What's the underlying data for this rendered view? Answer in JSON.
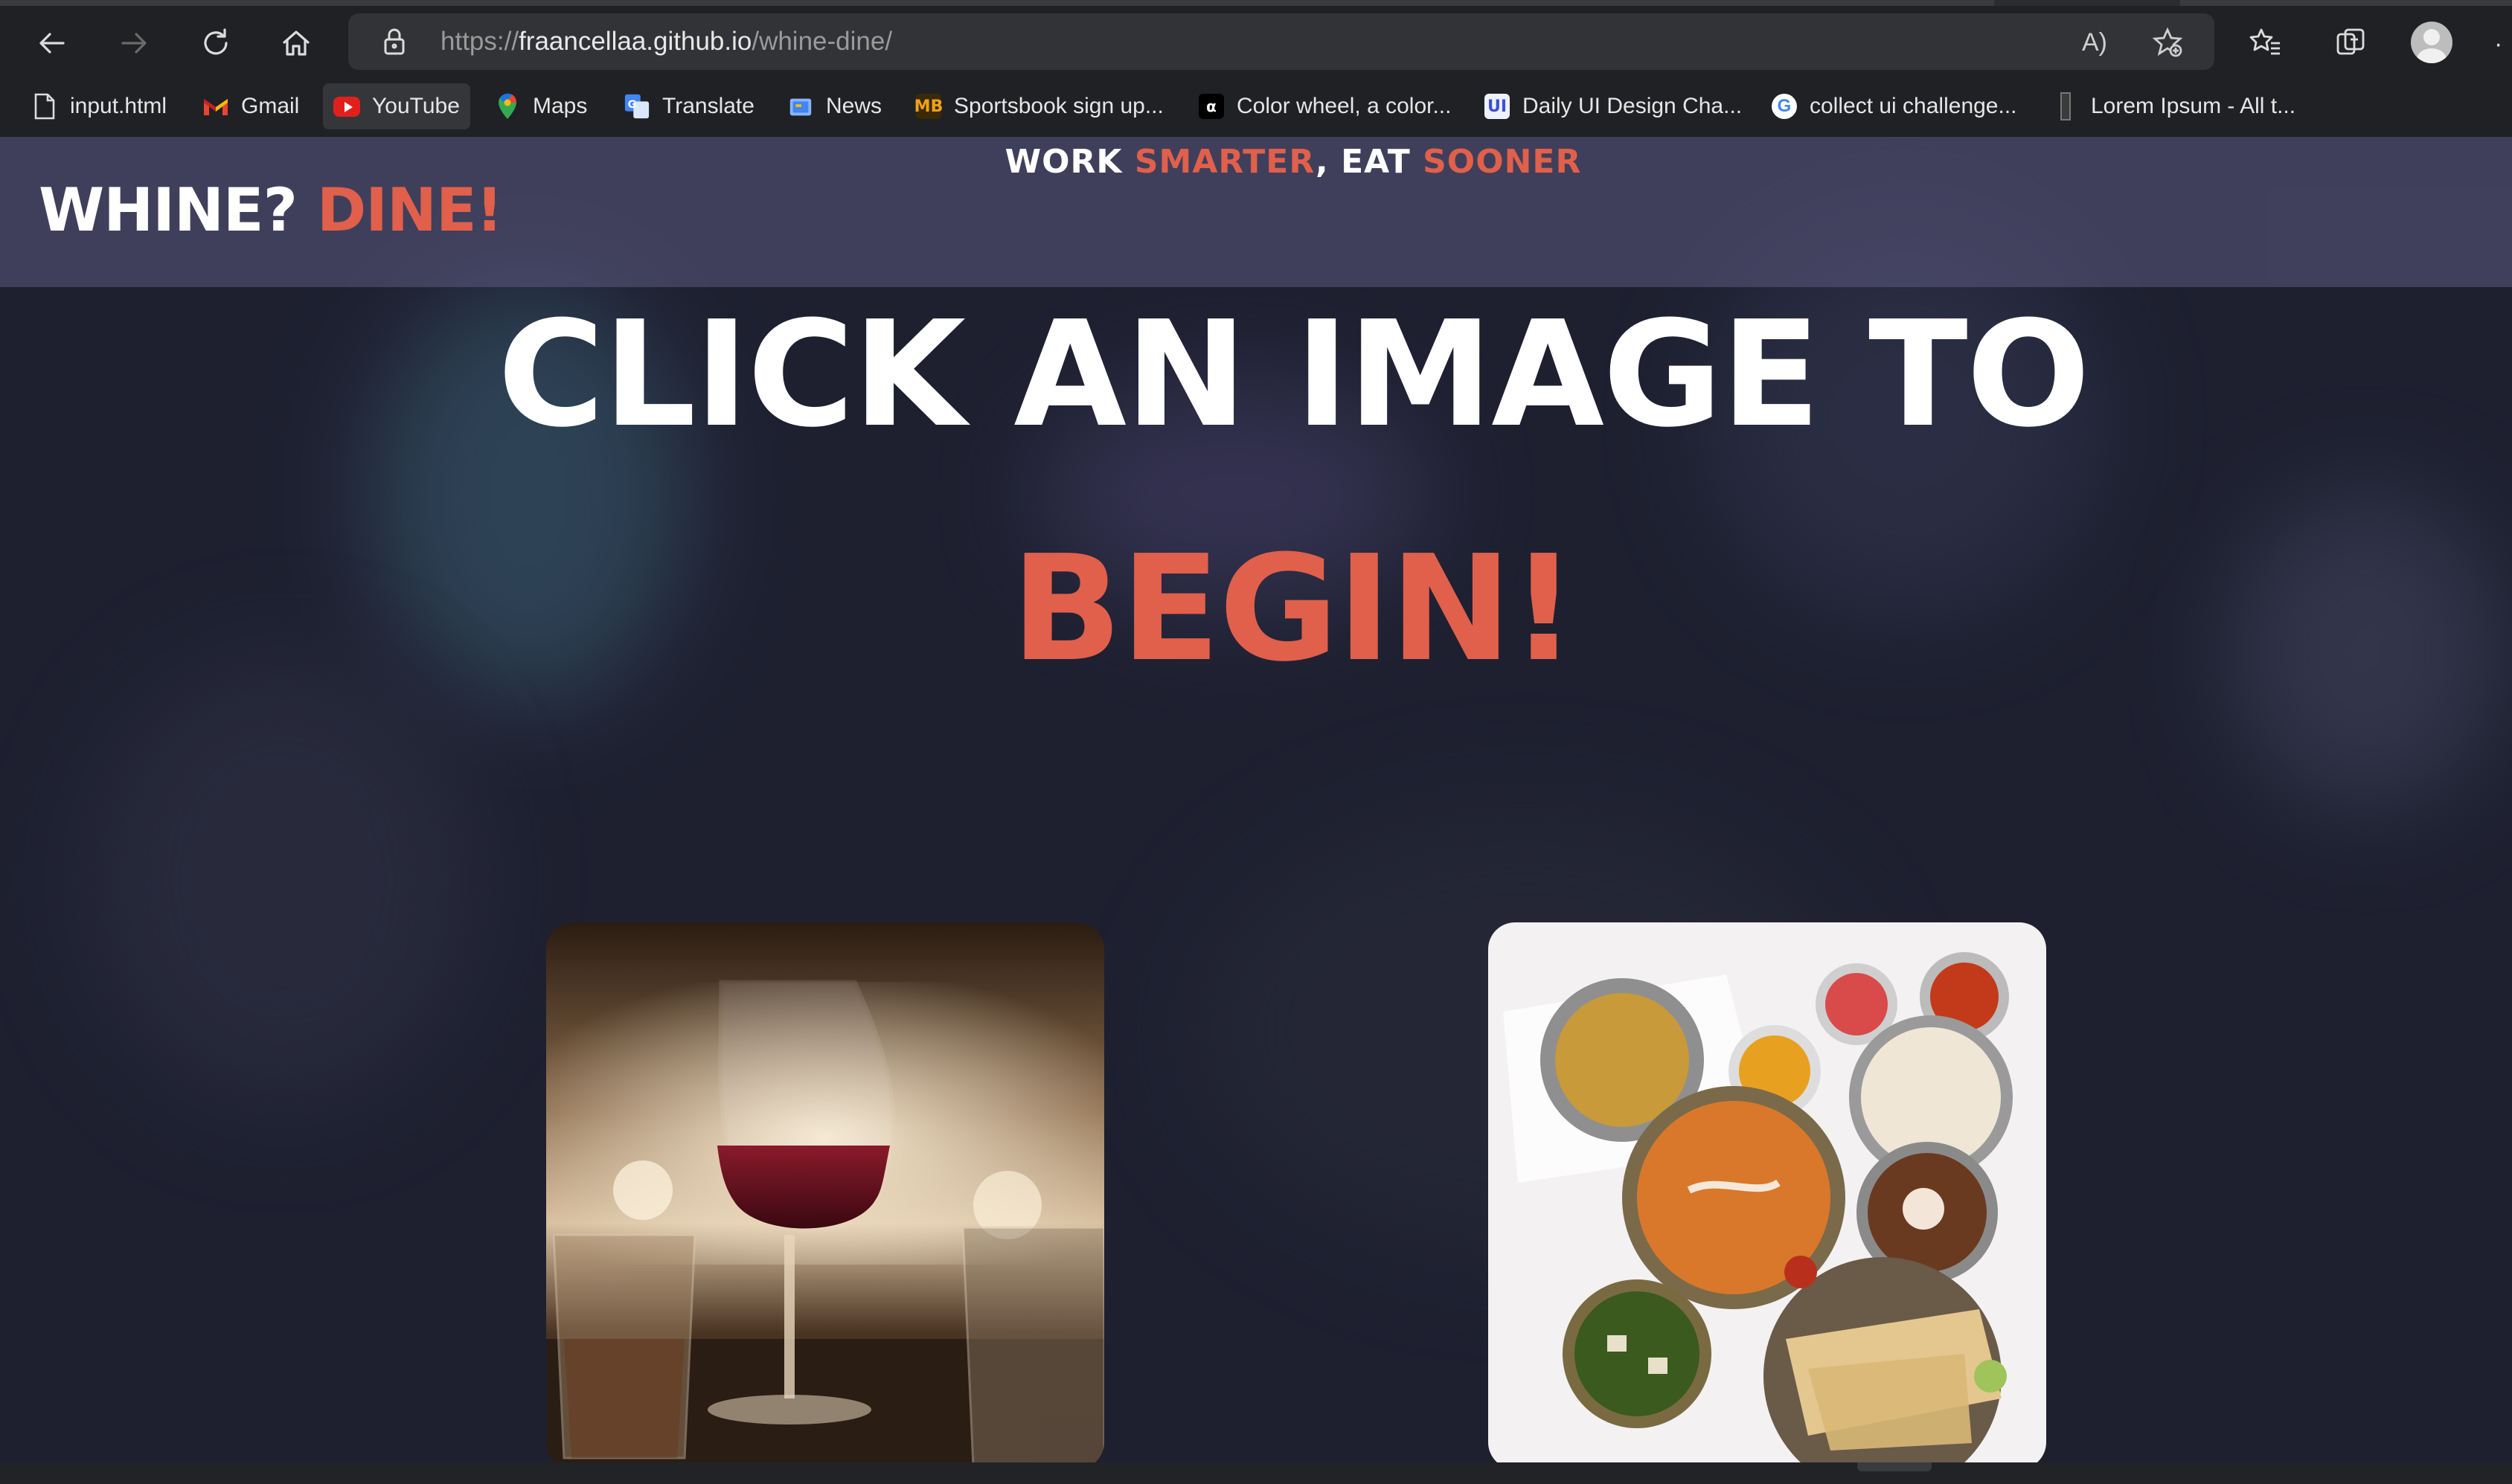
{
  "browser": {
    "url_scheme": "https://",
    "url_host": "fraancellaa.github.io",
    "url_path": "/whine-dine/",
    "read_aloud_label": "A)",
    "overflow_label": "·"
  },
  "bookmarks": [
    {
      "label": "input.html",
      "icon": "page-icon"
    },
    {
      "label": "Gmail",
      "icon": "gmail-icon"
    },
    {
      "label": "YouTube",
      "icon": "youtube-icon"
    },
    {
      "label": "Maps",
      "icon": "maps-icon"
    },
    {
      "label": "Translate",
      "icon": "translate-icon"
    },
    {
      "label": "News",
      "icon": "news-icon"
    },
    {
      "label": "Sportsbook sign up...",
      "icon": "mb-icon"
    },
    {
      "label": "Color wheel, a color...",
      "icon": "color-wheel-icon"
    },
    {
      "label": "Daily UI Design Cha...",
      "icon": "ui-icon"
    },
    {
      "label": "collect ui challenge...",
      "icon": "google-icon"
    },
    {
      "label": "Lorem Ipsum - All t...",
      "icon": "lorem-icon"
    }
  ],
  "site": {
    "tagline_1": "WORK ",
    "tagline_2": "SMARTER",
    "tagline_3": ", EAT ",
    "tagline_4": "SOONER",
    "logo_1": "WHINE? ",
    "logo_2": "DINE!",
    "hero_line1": "CLICK AN IMAGE TO",
    "hero_line2": "BEGIN!"
  },
  "colors": {
    "accent": "#e0604b",
    "page_bg": "#1e2030",
    "header_bg": "#4f4e6e",
    "chrome_bg": "#202124"
  }
}
